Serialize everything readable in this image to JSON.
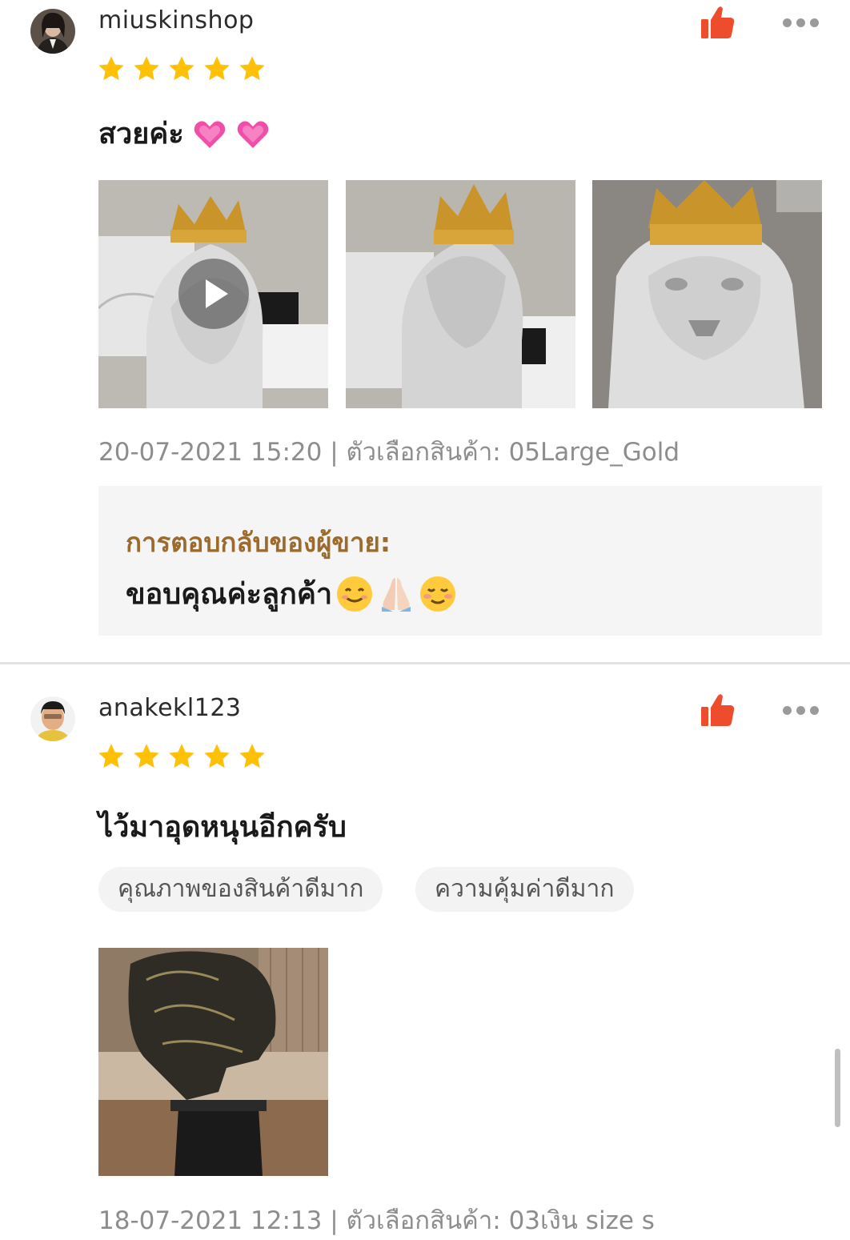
{
  "reviews": [
    {
      "username": "miuskinshop",
      "rating": 5,
      "comment": "สวยค่ะ",
      "comment_emojis": [
        "heart-emoji",
        "heart-emoji"
      ],
      "media_count": 3,
      "meta": "20-07-2021 15:20 | ตัวเลือกสินค้า: 05Large_Gold",
      "seller_reply": {
        "title": "การตอบกลับของผู้ขาย:",
        "text": "ขอบคุณค่ะลูกค้า",
        "emojis": [
          "smiling-face-emoji",
          "folded-hands-emoji",
          "blushing-face-emoji"
        ]
      }
    },
    {
      "username": "anakekl123",
      "rating": 5,
      "comment": "ไว้มาอุดหนุนอีกครับ",
      "tags": [
        "คุณภาพของสินค้าดีมาก",
        "ความคุ้มค่าดีมาก"
      ],
      "media_count": 1,
      "meta": "18-07-2021 12:13 | ตัวเลือกสินค้า: 03เงิน size s"
    }
  ],
  "colors": {
    "like": "#ee4d2d",
    "star": "#ffc107",
    "reply_title": "#9b6a2c",
    "meta_text": "#8d8d8d"
  },
  "icons": {
    "like": "thumbs-up-icon",
    "more": "more-dots-icon",
    "play": "play-icon",
    "star": "star-icon"
  }
}
